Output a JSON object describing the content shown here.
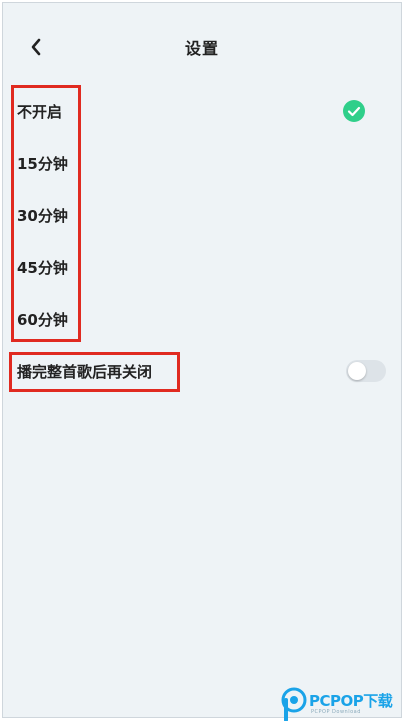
{
  "header": {
    "title": "设置",
    "back_icon": "chevron-left-icon"
  },
  "options": [
    {
      "label": "不开启",
      "selected": true
    },
    {
      "label": "15分钟",
      "selected": false
    },
    {
      "label": "30分钟",
      "selected": false
    },
    {
      "label": "45分钟",
      "selected": false
    },
    {
      "label": "60分钟",
      "selected": false
    }
  ],
  "finish_song": {
    "label": "播完整首歌后再关闭",
    "enabled": false
  },
  "colors": {
    "accent": "#2fcf8a",
    "highlight": "#e02a20",
    "background": "#eef3f6"
  },
  "watermark": {
    "logo_text": "PCPOP下载",
    "sub_text": "PCPOP Download"
  }
}
